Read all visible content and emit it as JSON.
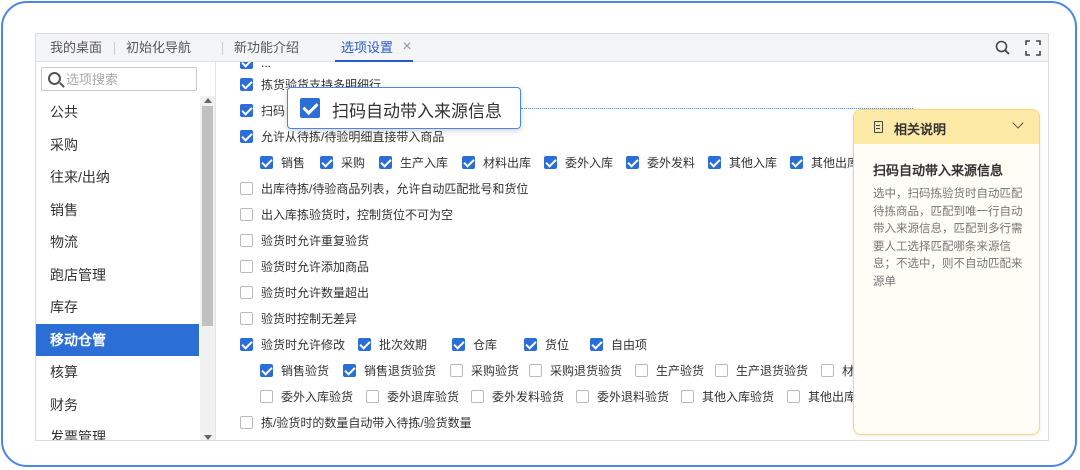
{
  "tabs": [
    {
      "label": "我的桌面"
    },
    {
      "label": "初始化导航"
    },
    {
      "label": "新功能介绍"
    },
    {
      "label": "选项设置",
      "active": true
    }
  ],
  "toolbar": {
    "icons": [
      "search-icon",
      "fullscreen-icon"
    ]
  },
  "sidebar": {
    "search_placeholder": "选项搜索",
    "items": [
      {
        "label": "公共"
      },
      {
        "label": "采购"
      },
      {
        "label": "往来/出纳"
      },
      {
        "label": "销售"
      },
      {
        "label": "物流"
      },
      {
        "label": "跑店管理"
      },
      {
        "label": "库存"
      },
      {
        "label": "移动仓管",
        "active": true
      },
      {
        "label": "核算"
      },
      {
        "label": "财务"
      },
      {
        "label": "发票管理"
      }
    ]
  },
  "options": {
    "top_partial": "...",
    "r1": {
      "label": "拣货验货支持多明细行",
      "checked": true
    },
    "r2": {
      "label": "扫码自",
      "checked": true
    },
    "r3": {
      "label": "允许从待拣/待验明细直接带入商品",
      "checked": true
    },
    "r3_subs": [
      {
        "label": "销售",
        "checked": true
      },
      {
        "label": "采购",
        "checked": true
      },
      {
        "label": "生产入库",
        "checked": true
      },
      {
        "label": "材料出库",
        "checked": true
      },
      {
        "label": "委外入库",
        "checked": true
      },
      {
        "label": "委外发料",
        "checked": true
      },
      {
        "label": "其他入库",
        "checked": true
      },
      {
        "label": "其他出库",
        "checked": true
      }
    ],
    "r4": {
      "label": "出库待拣/待验商品列表，允许自动匹配批号和货位",
      "checked": false
    },
    "r5": {
      "label": "出入库拣验货时，控制货位不可为空",
      "checked": false
    },
    "r6": {
      "label": "验货时允许重复验货",
      "checked": false
    },
    "r7": {
      "label": "验货时允许添加商品",
      "checked": false
    },
    "r8": {
      "label": "验货时允许数量超出",
      "checked": false
    },
    "r9": {
      "label": "验货时控制无差异",
      "checked": false
    },
    "r10": {
      "label": "验货时允许修改",
      "checked": true
    },
    "r10_subs": [
      {
        "label": "批次效期",
        "checked": true
      },
      {
        "label": "仓库",
        "checked": true
      },
      {
        "label": "货位",
        "checked": true
      },
      {
        "label": "自由项",
        "checked": true
      }
    ],
    "r11_subs": [
      {
        "label": "销售验货",
        "checked": true
      },
      {
        "label": "销售退货验货",
        "checked": true
      },
      {
        "label": "采购验货",
        "checked": false
      },
      {
        "label": "采购退货验货",
        "checked": false
      },
      {
        "label": "生产验货",
        "checked": false
      },
      {
        "label": "生产退货验货",
        "checked": false
      },
      {
        "label": "材",
        "checked": false
      }
    ],
    "r12_subs": [
      {
        "label": "委外入库验货",
        "checked": false
      },
      {
        "label": "委外退库验货",
        "checked": false
      },
      {
        "label": "委外发料验货",
        "checked": false
      },
      {
        "label": "委外退料验货",
        "checked": false
      },
      {
        "label": "其他入库验货",
        "checked": false
      },
      {
        "label": "其他出库验",
        "checked": false
      }
    ],
    "r13": {
      "label": "拣/验货时的数量自动带入待拣/验货数量",
      "checked": false
    }
  },
  "callout": {
    "label": "扫码自动带入来源信息",
    "checked": true
  },
  "help": {
    "header": "相关说明",
    "title": "扫码自动带入来源信息",
    "body": "选中，扫码拣验货时自动匹配待拣商品，匹配到唯一行自动带入来源信息，匹配到多行需要人工选择匹配哪条来源信息；不选中，则不自动匹配来源单"
  },
  "colors": {
    "accent": "#2b6fd6",
    "frame": "#4a86e8",
    "help_header": "#fde9a6",
    "help_border": "#f5d77a"
  }
}
